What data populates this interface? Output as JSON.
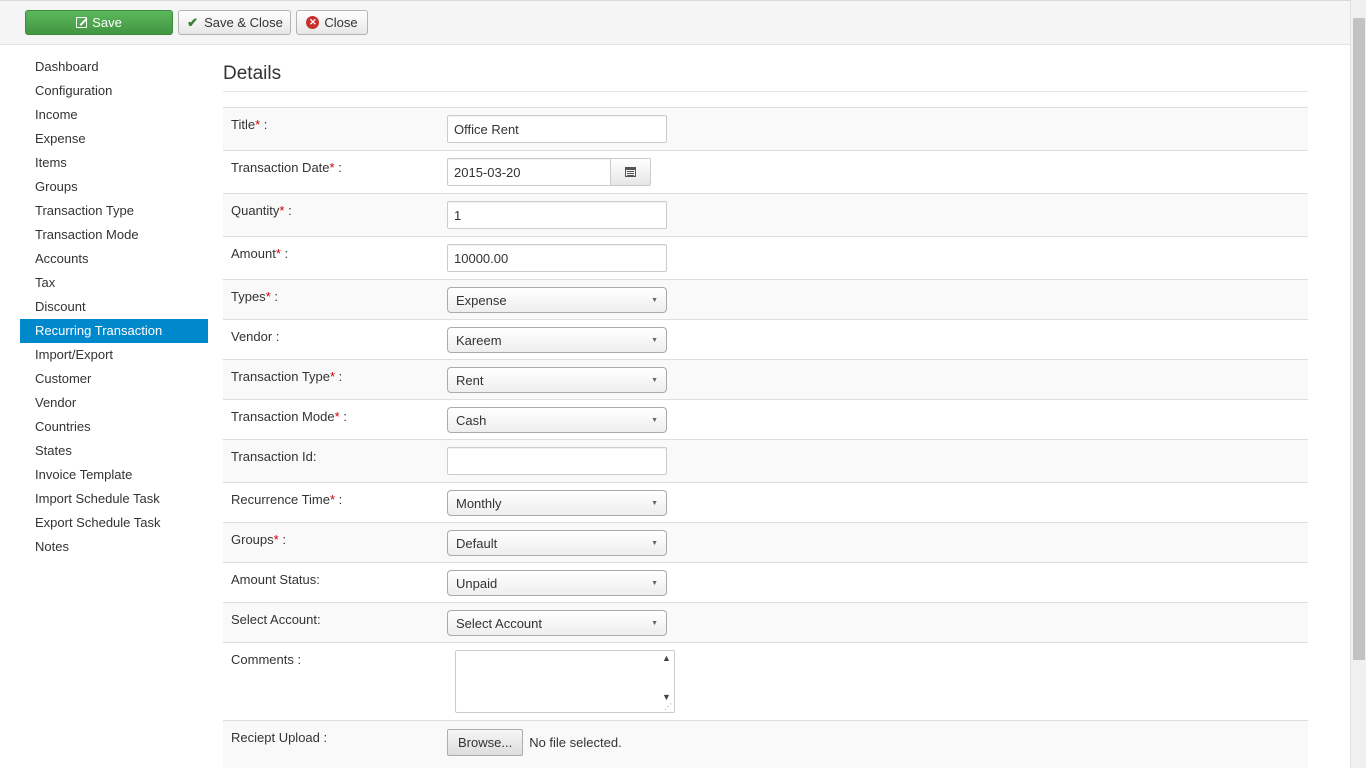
{
  "toolbar": {
    "save_label": "Save",
    "save_close_label": "Save & Close",
    "close_label": "Close"
  },
  "sidebar": {
    "items": [
      {
        "label": "Dashboard"
      },
      {
        "label": "Configuration"
      },
      {
        "label": "Income"
      },
      {
        "label": "Expense"
      },
      {
        "label": "Items"
      },
      {
        "label": "Groups"
      },
      {
        "label": "Transaction Type"
      },
      {
        "label": "Transaction Mode"
      },
      {
        "label": "Accounts"
      },
      {
        "label": "Tax"
      },
      {
        "label": "Discount"
      },
      {
        "label": "Recurring Transaction",
        "active": true
      },
      {
        "label": "Import/Export"
      },
      {
        "label": "Customer"
      },
      {
        "label": "Vendor"
      },
      {
        "label": "Countries"
      },
      {
        "label": "States"
      },
      {
        "label": "Invoice Template"
      },
      {
        "label": "Import Schedule Task"
      },
      {
        "label": "Export Schedule Task"
      },
      {
        "label": "Notes"
      }
    ]
  },
  "main": {
    "heading": "Details",
    "form": {
      "title": {
        "label": "Title",
        "value": "Office Rent"
      },
      "transaction_date": {
        "label": "Transaction Date",
        "value": "2015-03-20"
      },
      "quantity": {
        "label": "Quantity",
        "value": "1"
      },
      "amount": {
        "label": "Amount",
        "value": "10000.00"
      },
      "types": {
        "label": "Types",
        "value": "Expense"
      },
      "vendor": {
        "label": "Vendor :",
        "value": "Kareem"
      },
      "transaction_type": {
        "label": "Transaction Type",
        "value": "Rent"
      },
      "transaction_mode": {
        "label": "Transaction Mode",
        "value": "Cash"
      },
      "transaction_id": {
        "label": "Transaction Id:",
        "value": ""
      },
      "recurrence_time": {
        "label": "Recurrence Time",
        "value": "Monthly"
      },
      "groups": {
        "label": "Groups",
        "value": "Default"
      },
      "amount_status": {
        "label": "Amount Status:",
        "value": "Unpaid"
      },
      "select_account": {
        "label": "Select Account:",
        "value": "Select Account"
      },
      "comments": {
        "label": "Comments :",
        "value": ""
      },
      "receipt_upload": {
        "label": "Reciept Upload :",
        "browse_label": "Browse...",
        "status": "No file selected."
      }
    },
    "required_mark": "*",
    "colon": " :"
  }
}
